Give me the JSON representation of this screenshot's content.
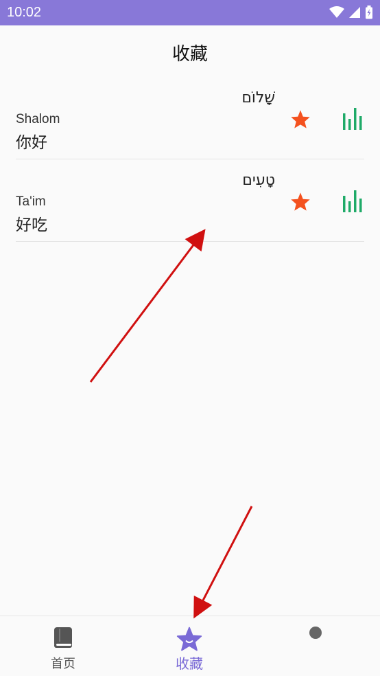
{
  "status_bar": {
    "time": "10:02",
    "icons": [
      "wifi-icon",
      "signal-icon",
      "battery-icon"
    ],
    "bg_color": "#8878d8"
  },
  "page": {
    "title": "收藏"
  },
  "favorites": [
    {
      "hebrew": "שָׁלוֹם",
      "transliteration": "Shalom",
      "meaning": "你好",
      "favorited": true
    },
    {
      "hebrew": "טָעִים",
      "transliteration": "Ta'im",
      "meaning": "好吃",
      "favorited": true
    }
  ],
  "colors": {
    "star": "#f4511e",
    "bars": "#1faa68",
    "accent": "#7a6ad6",
    "annotation_arrow": "#d01010"
  },
  "bottom_nav": {
    "items": [
      {
        "label": "首页",
        "icon": "book-icon",
        "active": false
      },
      {
        "label": "收藏",
        "icon": "star-icon",
        "active": true
      },
      {
        "label": "",
        "icon": "dot-icon",
        "active": false
      }
    ]
  }
}
